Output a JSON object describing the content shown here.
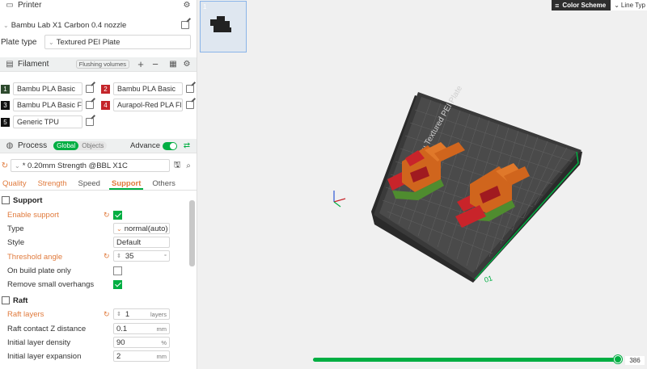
{
  "printer": {
    "title": "Printer",
    "machine": "Bambu Lab X1 Carbon 0.4 nozzle",
    "plate_label": "Plate type",
    "plate_value": "Textured PEI Plate"
  },
  "filament": {
    "title": "Filament",
    "flush_label": "Flushing volumes",
    "items": [
      {
        "num": "1",
        "name": "Bambu PLA Basic",
        "color": "#2d4a2d"
      },
      {
        "num": "2",
        "name": "Bambu PLA Basic",
        "color": "#c4252a"
      },
      {
        "num": "3",
        "name": "Bambu PLA Basic Fl...",
        "color": "#111111"
      },
      {
        "num": "4",
        "name": "Aurapol-Red PLA Fl...",
        "color": "#c4252a"
      },
      {
        "num": "5",
        "name": "Generic TPU",
        "color": "#111111"
      }
    ]
  },
  "process": {
    "title": "Process",
    "global_label": "Global",
    "objects_label": "Objects",
    "advance_label": "Advance",
    "preset": "* 0.20mm Strength @BBL X1C"
  },
  "tabs": [
    "Quality",
    "Strength",
    "Speed",
    "Support",
    "Others"
  ],
  "support": {
    "title": "Support",
    "enable_label": "Enable support",
    "type_label": "Type",
    "type_value": "normal(auto)",
    "style_label": "Style",
    "style_value": "Default",
    "threshold_label": "Threshold angle",
    "threshold_value": "35",
    "threshold_unit": "°",
    "build_plate_label": "On build plate only",
    "remove_label": "Remove small overhangs"
  },
  "raft": {
    "title": "Raft",
    "layers_label": "Raft layers",
    "layers_value": "1",
    "layers_unit": "layers",
    "contact_label": "Raft contact Z distance",
    "contact_value": "0.1",
    "contact_unit": "mm",
    "density_label": "Initial layer density",
    "density_value": "90",
    "density_unit": "%",
    "expansion_label": "Initial layer expansion",
    "expansion_value": "2",
    "expansion_unit": "mm"
  },
  "viewport": {
    "plate_thumb_num": "1",
    "color_scheme_label": "Color Scheme",
    "line_type_label": "Line Typ",
    "plate_text": "Bambu Textured PEI Plate",
    "plate_corner_label": "01",
    "layer_value": "386",
    "layer_fraction": 1.0
  }
}
